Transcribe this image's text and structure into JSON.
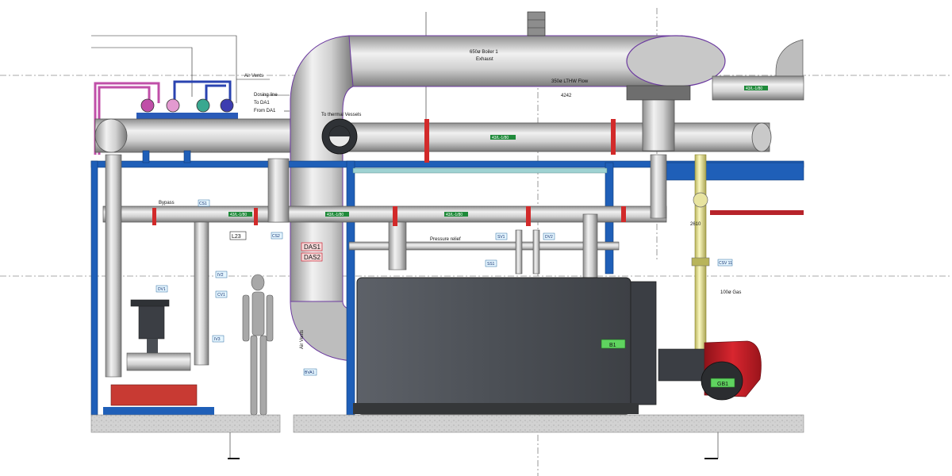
{
  "labels": {
    "air_vents_top": "Air Vents",
    "dosing_line": "Dosing line",
    "to_da1": "To DA1",
    "from_da1": "From DA1",
    "to_thermal_vessels": "To thermal Vessels",
    "boiler_exhaust_line1": "650ø Boiler 1",
    "boiler_exhaust_line2": "Exhaust",
    "lthw_flow": "350ø LTHW Flow",
    "bypass": "Bypass",
    "pressure_relief": "Pressure relief",
    "air_vents_vertical": "Air Vents",
    "gas": "100ø Gas",
    "l23": "L23",
    "das1": "DAS1",
    "das2": "DAS2",
    "b1": "B1",
    "gb1": "GB1",
    "dim_top": "4242",
    "dim_right": "2610"
  },
  "tags": {
    "c1": "CS1",
    "c2": "CS2",
    "iv2": "IV2",
    "cv1": "CV1",
    "iv3": "IV3",
    "dv1": "DV1",
    "sv1": "SV1",
    "dv2": "DV2",
    "ss1": "SS1",
    "bva1": "BVA1",
    "csv1": "CSV 11"
  },
  "pipe_labels": {
    "p1": "43/L-1/80",
    "p2": "43/L-1/80",
    "p3": "43/L-1/80",
    "p4": "43/L-1/80",
    "p5": "43/L-1/80"
  },
  "colors": {
    "steel_blue": "#1f5fb8",
    "pipe_grey": "#c7c7c7",
    "boiler_body": "#4a4e54",
    "burner_red": "#c8202b",
    "gas_yellow": "#f3f0a0",
    "valve_red": "#d22a2a",
    "tag_green": "#1f8a3a",
    "floor": "#cfcfcf"
  }
}
